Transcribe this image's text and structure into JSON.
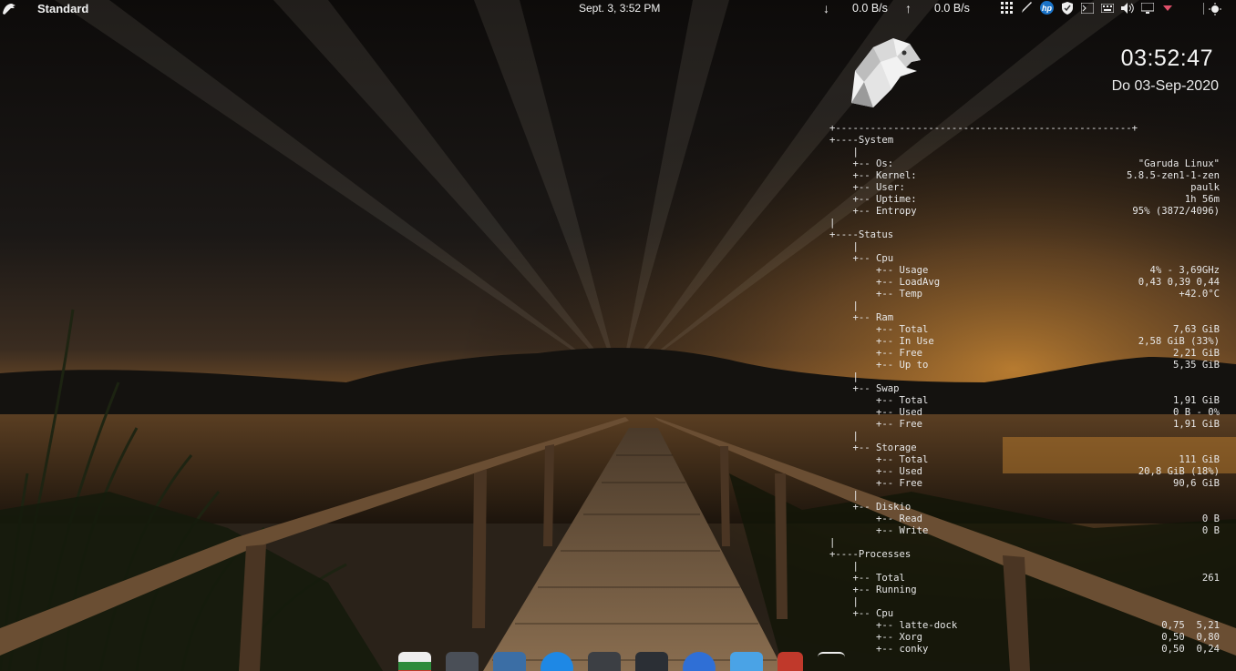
{
  "top_panel": {
    "activity_name": "Standard",
    "clock": "Sept. 3, 3:52 PM",
    "net_down_icon": "↓",
    "net_down": "0.0 B/s",
    "net_up_icon": "↑",
    "net_up": "0.0 B/s",
    "hp_label": "hp",
    "tray_icons": [
      "grid-icon",
      "brush-icon",
      "hp-icon",
      "shield-icon",
      "terminal-icon",
      "keyboard-icon",
      "volume-icon",
      "display-icon",
      "chevron-down-icon",
      "network-icon"
    ]
  },
  "conky": {
    "time": "03:52:47",
    "date": "Do 03-Sep-2020",
    "border": "+---------------------------------------------------+",
    "lines": [
      {
        "label": "+----System",
        "value": ""
      },
      {
        "label": "    |",
        "value": ""
      },
      {
        "label": "    +-- Os:",
        "value": "\"Garuda Linux\""
      },
      {
        "label": "    +-- Kernel:",
        "value": "5.8.5-zen1-1-zen"
      },
      {
        "label": "    +-- User:",
        "value": "paulk"
      },
      {
        "label": "    +-- Uptime:",
        "value": "1h 56m"
      },
      {
        "label": "    +-- Entropy",
        "value": "95% (3872/4096)"
      },
      {
        "label": "|",
        "value": ""
      },
      {
        "label": "+----Status",
        "value": ""
      },
      {
        "label": "    |",
        "value": ""
      },
      {
        "label": "    +-- Cpu",
        "value": ""
      },
      {
        "label": "        +-- Usage",
        "value": "4% - 3,69GHz"
      },
      {
        "label": "        +-- LoadAvg",
        "value": "0,43 0,39 0,44"
      },
      {
        "label": "        +-- Temp",
        "value": "+42.0°C"
      },
      {
        "label": "    |",
        "value": ""
      },
      {
        "label": "    +-- Ram",
        "value": ""
      },
      {
        "label": "        +-- Total",
        "value": "7,63 GiB"
      },
      {
        "label": "        +-- In Use",
        "value": "2,58 GiB (33%)"
      },
      {
        "label": "        +-- Free",
        "value": "2,21 GiB"
      },
      {
        "label": "        +-- Up to",
        "value": "5,35 GiB"
      },
      {
        "label": "    |",
        "value": ""
      },
      {
        "label": "    +-- Swap",
        "value": ""
      },
      {
        "label": "        +-- Total",
        "value": "1,91 GiB"
      },
      {
        "label": "        +-- Used",
        "value": "0 B - 0%"
      },
      {
        "label": "        +-- Free",
        "value": "1,91 GiB"
      },
      {
        "label": "    |",
        "value": ""
      },
      {
        "label": "    +-- Storage",
        "value": ""
      },
      {
        "label": "        +-- Total",
        "value": "111 GiB"
      },
      {
        "label": "        +-- Used",
        "value": "20,8 GiB (18%)"
      },
      {
        "label": "        +-- Free",
        "value": "90,6 GiB"
      },
      {
        "label": "    |",
        "value": ""
      },
      {
        "label": "    +-- Diskio",
        "value": ""
      },
      {
        "label": "        +-- Read",
        "value": "0 B"
      },
      {
        "label": "        +-- Write",
        "value": "0 B"
      },
      {
        "label": "|",
        "value": ""
      },
      {
        "label": "+----Processes",
        "value": ""
      },
      {
        "label": "    |",
        "value": ""
      },
      {
        "label": "    +-- Total",
        "value": "261"
      },
      {
        "label": "    +-- Running",
        "value": ""
      },
      {
        "label": "    |",
        "value": ""
      },
      {
        "label": "    +-- Cpu",
        "value": ""
      },
      {
        "label": "        +-- latte-dock",
        "value": "0,75  5,21"
      },
      {
        "label": "        +-- Xorg",
        "value": "0,50  0,80"
      },
      {
        "label": "        +-- conky",
        "value": "0,50  0,24"
      }
    ]
  },
  "dock": {
    "items": [
      "file-manager-icon",
      "terminal-icon",
      "downloader-icon",
      "installer-icon",
      "calculator-icon",
      "settings-icon",
      "browser-icon",
      "software-store-icon",
      "trash-icon",
      "menu-icon"
    ]
  },
  "colors": {
    "text": "#e7e7e7",
    "sky_glow": "#c8852f"
  }
}
